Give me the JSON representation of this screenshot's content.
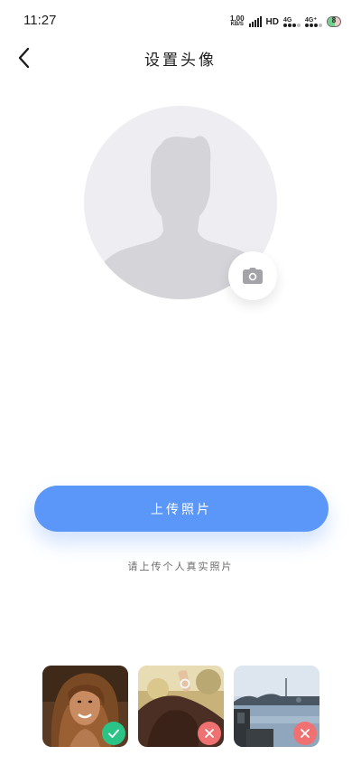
{
  "status_bar": {
    "time": "11:27",
    "net_speed_value": "1.00",
    "net_speed_unit": "KB/S",
    "hd_label": "HD",
    "signal_1_label": "4G",
    "signal_2_label": "4G⁺",
    "battery_level": "8"
  },
  "header": {
    "title": "设置头像",
    "back_icon": "chevron-left-icon"
  },
  "avatar": {
    "placeholder_icon": "person-silhouette-icon",
    "camera_icon": "camera-icon"
  },
  "upload": {
    "button_label": "上传照片",
    "hint": "请上传个人真实照片"
  },
  "examples": [
    {
      "kind": "portrait-smiling-woman",
      "status": "valid",
      "status_icon": "check-icon"
    },
    {
      "kind": "back-of-head-outdoors",
      "status": "invalid",
      "status_icon": "close-icon"
    },
    {
      "kind": "landscape-seaside",
      "status": "invalid",
      "status_icon": "close-icon"
    }
  ],
  "colors": {
    "accent": "#5b97f8",
    "valid": "#2bc486",
    "invalid": "#f07171",
    "avatar_bg": "#eeeef2",
    "silhouette": "#d4d4d9"
  }
}
